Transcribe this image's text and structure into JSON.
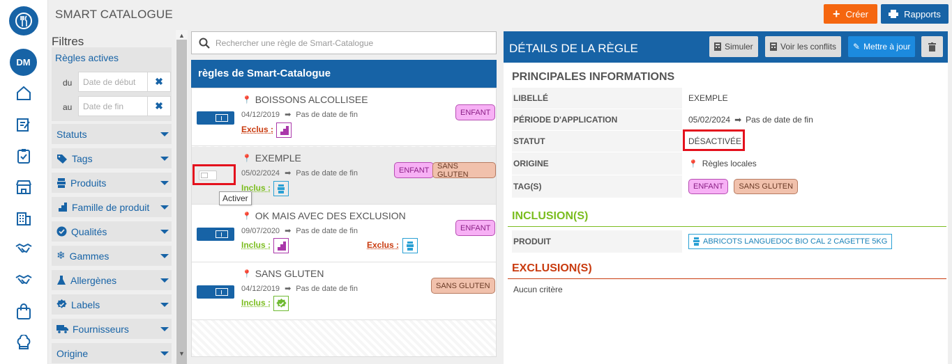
{
  "app": {
    "title": "SMART CATALOGUE"
  },
  "header": {
    "create_label": "Créer",
    "reports_label": "Rapports"
  },
  "user": {
    "initials": "DM"
  },
  "nav": [
    "home-icon",
    "edit-icon",
    "clipboard-icon",
    "store-icon",
    "building-icon",
    "handshake-icon",
    "handshake-icon",
    "basket-icon",
    "chef-hat-icon"
  ],
  "filters": {
    "title": "Filtres",
    "active_rules": "Règles actives",
    "from_label": "du",
    "to_label": "au",
    "start_placeholder": "Date de début",
    "end_placeholder": "Date de fin",
    "facets": [
      "Statuts",
      "Tags",
      "Produits",
      "Famille de produit",
      "Qualités",
      "Gammes",
      "Allergènes",
      "Labels",
      "Fournisseurs",
      "Origine"
    ]
  },
  "search": {
    "placeholder": "Rechercher une règle de Smart-Catalogue"
  },
  "rules": {
    "header": "règles de Smart-Catalogue",
    "no_end": "Pas de date de fin",
    "include_label": "Inclus :",
    "exclude_label": "Exclus :",
    "items": [
      {
        "title": "BOISSONS ALCOLLISEE",
        "date": "04/12/2019",
        "active": true,
        "tags": [
          "ENFANT"
        ]
      },
      {
        "title": "EXEMPLE",
        "date": "05/02/2024",
        "active": false,
        "tags": [
          "ENFANT",
          "SANS GLUTEN"
        ]
      },
      {
        "title": "OK MAIS AVEC DES EXCLUSION",
        "date": "09/07/2020",
        "active": true,
        "tags": [
          "ENFANT"
        ]
      },
      {
        "title": "SANS GLUTEN",
        "date": "04/12/2019",
        "active": true,
        "tags": [
          "SANS GLUTEN"
        ]
      }
    ],
    "tooltip": "Activer"
  },
  "detail": {
    "title": "DÉTAILS DE LA RÈGLE",
    "simulate_label": "Simuler",
    "conflicts_label": "Voir les conflits",
    "update_label": "Mettre à jour",
    "main_section": "PRINCIPALES INFORMATIONS",
    "rows": {
      "label_key": "LIBELLÉ",
      "label_val": "EXEMPLE",
      "period_key": "PÉRIODE D'APPLICATION",
      "period_start": "05/02/2024",
      "period_end": "Pas de date de fin",
      "status_key": "STATUT",
      "status_val": "DÉSACTIVÉE",
      "origin_key": "ORIGINE",
      "origin_val": "Règles locales",
      "tags_key": "TAG(S)",
      "tag1": "ENFANT",
      "tag2": "SANS GLUTEN"
    },
    "inclusions_title": "INCLUSION(S)",
    "product_key": "PRODUIT",
    "product_val": "ABRICOTS LANGUEDOC BIO CAL 2 CAGETTE 5KG",
    "exclusions_title": "EXCLUSION(S)",
    "no_criteria": "Aucun critère"
  },
  "colors": {
    "primary": "#1763a6",
    "orange": "#f5660f",
    "include": "#7bbd1f",
    "exclude": "#c93b0f",
    "highlight": "#e4111d"
  }
}
